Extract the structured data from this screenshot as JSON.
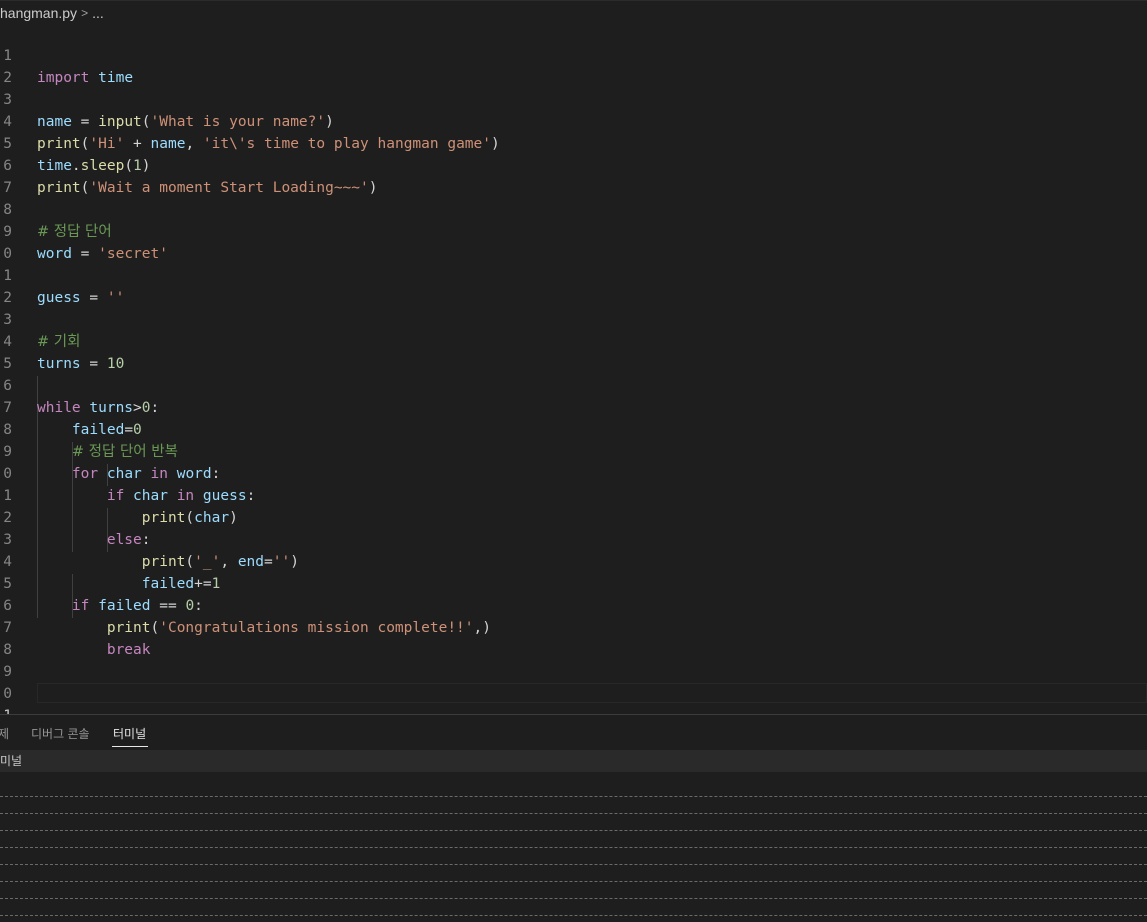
{
  "breadcrumb": {
    "file": "hangman.py",
    "separator": ">",
    "ellipsis": "..."
  },
  "editor": {
    "line_numbers": [
      "1",
      "2",
      "3",
      "4",
      "5",
      "6",
      "7",
      "8",
      "9",
      "0",
      "1",
      "2",
      "3",
      "4",
      "5",
      "6",
      "7",
      "8",
      "9",
      "0",
      "1",
      "2",
      "3",
      "4",
      "5",
      "6",
      "7",
      "8",
      "9",
      "0",
      "1"
    ],
    "active_line": 31,
    "code": {
      "l1_import": "import",
      "l1_module": "time",
      "l3_var": "name",
      "l3_eq": " = ",
      "l3_fn": "input",
      "l3_open": "(",
      "l3_str": "'What is your name?'",
      "l3_close": ")",
      "l4_fn": "print",
      "l4_open": "(",
      "l4_str1": "'Hi'",
      "l4_plus": " + ",
      "l4_var": "name",
      "l4_comma": ", ",
      "l4_str2": "'it\\'s time to play hangman game'",
      "l4_close": ")",
      "l5_mod": "time",
      "l5_dot": ".",
      "l5_fn": "sleep",
      "l5_open": "(",
      "l5_num": "1",
      "l5_close": ")",
      "l6_fn": "print",
      "l6_open": "(",
      "l6_str": "'Wait a moment Start Loading~~~'",
      "l6_close": ")",
      "l8_comment": "# 정답 단어",
      "l9_var": "word",
      "l9_eq": " = ",
      "l9_str": "'secret'",
      "l11_var": "guess",
      "l11_eq": " = ",
      "l11_str": "''",
      "l13_comment": "# 기회",
      "l14_var": "turns",
      "l14_eq": " = ",
      "l14_num": "10",
      "l16_kw": "while",
      "l16_var": "turns",
      "l16_op": ">",
      "l16_num": "0",
      "l16_colon": ":",
      "l17_var": "failed",
      "l17_op": "=",
      "l17_num": "0",
      "l18_comment": "# 정답 단어 반복",
      "l19_kw": "for",
      "l19_var1": "char",
      "l19_in": "in",
      "l19_var2": "word",
      "l19_colon": ":",
      "l20_kw": "if",
      "l20_var1": "char",
      "l20_in": "in",
      "l20_var2": "guess",
      "l20_colon": ":",
      "l21_fn": "print",
      "l21_open": "(",
      "l21_var": "char",
      "l21_close": ")",
      "l22_kw": "else",
      "l22_colon": ":",
      "l23_fn": "print",
      "l23_open": "(",
      "l23_str1": "'_'",
      "l23_comma": ", ",
      "l23_param": "end",
      "l23_eq": "=",
      "l23_str2": "''",
      "l23_close": ")",
      "l24_var": "failed",
      "l24_op": "+=",
      "l24_num": "1",
      "l25_kw": "if",
      "l25_var": "failed",
      "l25_op": " == ",
      "l25_num": "0",
      "l25_colon": ":",
      "l26_fn": "print",
      "l26_open": "(",
      "l26_str": "'Congratulations mission complete!!'",
      "l26_close": ",)",
      "l27_kw": "break"
    }
  },
  "panel": {
    "tabs": [
      {
        "label": "제"
      },
      {
        "label": "디버그 콘솔"
      },
      {
        "label": "터미널"
      }
    ],
    "active_tab": "터미널",
    "terminal_header": "미널"
  },
  "colors": {
    "background": "#1e1e1e",
    "keyword": "#c586c0",
    "variable": "#9cdcfe",
    "function": "#dcdcaa",
    "string": "#ce9178",
    "number": "#b5cea8",
    "comment": "#6a9955"
  }
}
